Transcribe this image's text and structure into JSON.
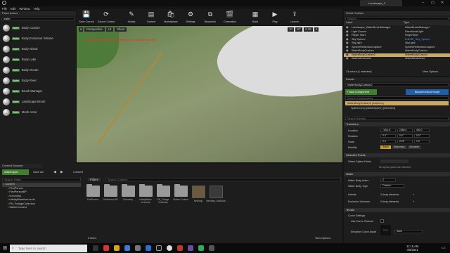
{
  "window": {
    "title": "Landscape_3",
    "icon": "ue-logo-icon"
  },
  "menu": [
    "File",
    "Edit",
    "Window",
    "Help"
  ],
  "place_actors": {
    "tab": "Place Actors",
    "search_value": "water",
    "items": [
      {
        "label": "Body Custom"
      },
      {
        "label": "Body Exclusion Volume"
      },
      {
        "label": "Body Island"
      },
      {
        "label": "Body Lake"
      },
      {
        "label": "Body Ocean"
      },
      {
        "label": "Body River"
      },
      {
        "label": "Brush Manager"
      },
      {
        "label": "Landscape Brush"
      },
      {
        "label": "Mesh Actor"
      }
    ],
    "badge": "Water"
  },
  "toolbar": [
    {
      "label": "Save Current",
      "icon": "save-icon"
    },
    {
      "label": "Source Control",
      "icon": "source-control-icon"
    },
    {
      "label": "Modes",
      "icon": "modes-icon"
    },
    {
      "label": "Content",
      "icon": "content-icon"
    },
    {
      "label": "Marketplace",
      "icon": "marketplace-icon"
    },
    {
      "label": "Settings",
      "icon": "settings-icon"
    },
    {
      "label": "Blueprints",
      "icon": "blueprints-icon"
    },
    {
      "label": "Cinematics",
      "icon": "cinematics-icon"
    },
    {
      "label": "Build",
      "icon": "build-icon"
    },
    {
      "label": "Play",
      "icon": "play-icon"
    },
    {
      "label": "Launch",
      "icon": "launch-icon"
    }
  ],
  "viewport": {
    "perspective": "Perspective",
    "lit": "Lit",
    "show": "Show",
    "warning": "LIGHTING NEEDS TO BE REBUILT (3 unbuilt objects)",
    "grid": "10",
    "angle": "10°",
    "scale": "0.25",
    "cam": "4"
  },
  "world_outliner": {
    "tab": "World Outliner",
    "search_placeholder": "Search...",
    "col_label": "Label",
    "col_type": "Type",
    "rows": [
      {
        "label": "Landscape_WaterBrushManager",
        "type": "WaterBrushManager"
      },
      {
        "label": "Light Source",
        "type": "DirectionalLight"
      },
      {
        "label": "Player Start",
        "type": "PlayerStart"
      },
      {
        "label": "Sky Sphere",
        "type": "Edit BP_Sky_Sphere"
      },
      {
        "label": "SkyLight",
        "type": "SkyLight"
      },
      {
        "label": "SphereReflectionCapture",
        "type": "SphereReflectionCapture"
      },
      {
        "label": "WaterBodyCustom",
        "type": "WaterBodyCustom"
      },
      {
        "label": "WaterBodyCustom2",
        "type": "WaterBodyCustom"
      },
      {
        "label": "WaterMeshActor",
        "type": "WaterMeshActor"
      }
    ],
    "status": "13 actors (1 selected)",
    "view_options": "View Options"
  },
  "details": {
    "tab": "Details",
    "name": "WaterBodyCustom2",
    "add_component": "+ Add Component",
    "blueprint_button": "Blueprint/Add Script",
    "search_placeholder": "Search Components",
    "instance": "WaterBodyCustom2 (Instance)",
    "spline": "SplineComp (WaterSpline) (Inherited)",
    "search_details": "Search Details",
    "transform": {
      "title": "Transform",
      "location": {
        "label": "Location",
        "x": "-1611.8",
        "y": "2386.0",
        "z": "460.0"
      },
      "rotation": {
        "label": "Rotation",
        "x": "0.0 °",
        "y": "0.0 °",
        "z": "0.0 °"
      },
      "scale": {
        "label": "Scale",
        "x": "0.0",
        "y": "2.25",
        "z": "1.0"
      },
      "mobility": {
        "label": "Mobility",
        "static": "Static",
        "stationary": "Stationary",
        "movable": "Movable"
      }
    },
    "selected_points": {
      "title": "Selected Points",
      "select_spline": "Select Spline Points",
      "no_spline": "No spline points are selected"
    },
    "water": {
      "title": "Water",
      "index_label": "Water Body Index",
      "index": "0",
      "type_label": "Water Body Type",
      "type": "Custom",
      "islands": "Islands",
      "islands_val": "0 Array elements",
      "exclusion": "Exclusion Volumes",
      "exclusion_val": "0 Array elements"
    },
    "terrain": {
      "title": "Terrain",
      "curve_settings": "Curve Settings",
      "use_curve": "Use Curve Channel",
      "elev_label": "Elevation Curve Asset",
      "elev_val": "None",
      "elev_thumb": "None"
    }
  },
  "content_browser": {
    "tab": "Content Browser",
    "add_import": "Add/Import",
    "save_all": "Save All",
    "path": "Content",
    "search_paths": "Search Paths",
    "filters": "Filters",
    "search_placeholder": "Search Content",
    "tree": [
      "Content",
      "FirstPerson",
      "FirstPersonBP",
      "Geometry",
      "InfinityBladeIceLands",
      "PN_FoliageCollection",
      "StarterContent"
    ],
    "items": [
      {
        "label": "FirstPerson"
      },
      {
        "label": "FirstPerson BP"
      },
      {
        "label": "Geometry"
      },
      {
        "label": "InfinityBlade IceLands"
      },
      {
        "label": "PN_Foliage Collection"
      },
      {
        "label": "Starter Content"
      },
      {
        "label": "NewMap"
      },
      {
        "label": "NewMap_BuiltData"
      }
    ],
    "item_count": "8 items",
    "view_options": "View Options"
  },
  "taskbar": {
    "search_placeholder": "Type here to search",
    "time": "11:15 AM",
    "date": "4/6/2021"
  }
}
